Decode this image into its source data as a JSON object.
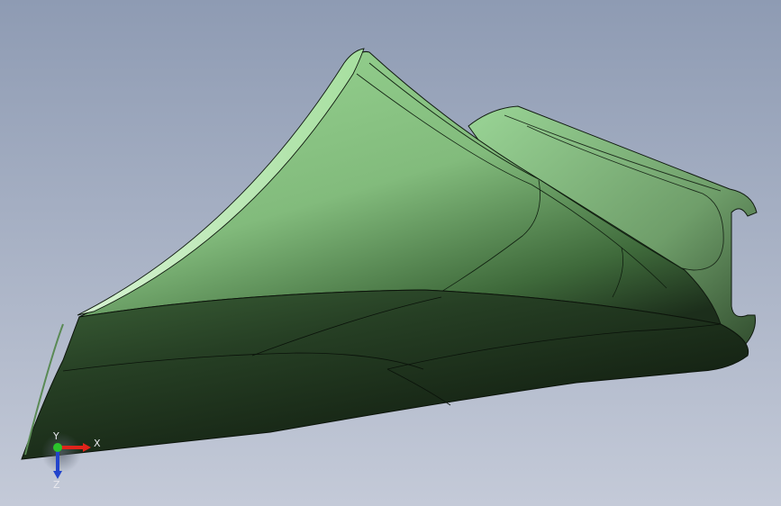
{
  "viewport": {
    "background_top": "#8e9bb3",
    "background_bottom": "#c4cad8"
  },
  "part": {
    "color_light": "#8fcf8a",
    "color_mid": "#6fa86a",
    "color_dark": "#1f2d1d",
    "edge_color": "#0f140e"
  },
  "triad": {
    "x_label": "X",
    "y_label": "Y",
    "z_label": "Z",
    "x_color": "#e0241b",
    "y_color": "#2bc42b",
    "z_color": "#2244cc"
  }
}
